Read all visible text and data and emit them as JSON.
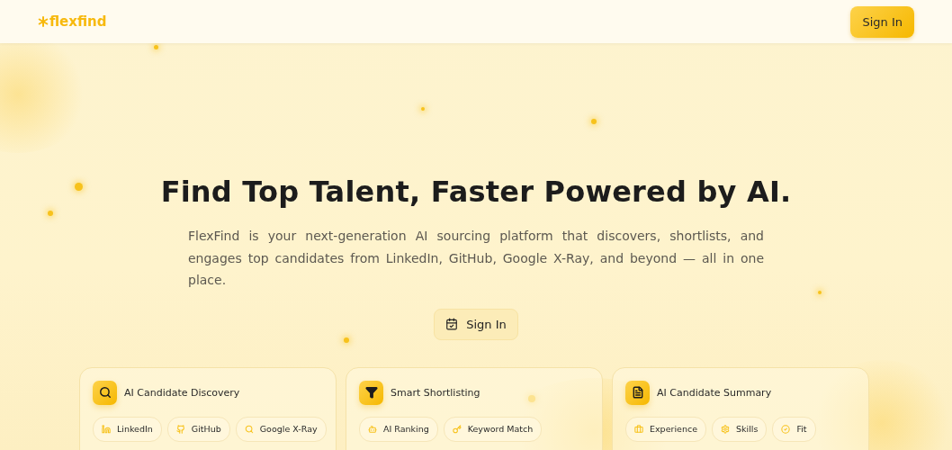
{
  "header": {
    "logo": "flexfind",
    "sign_in": "Sign In"
  },
  "hero": {
    "title": "Find Top Talent, Faster Powered by AI.",
    "description": "FlexFind is your next-generation AI sourcing platform that discovers, shortlists, and engages top candidates from LinkedIn, GitHub, Google X-Ray, and beyond — all in one place.",
    "button": "Sign In"
  },
  "features": [
    {
      "title": "AI Candidate Discovery",
      "tags": [
        "LinkedIn",
        "GitHub",
        "Google X-Ray"
      ]
    },
    {
      "title": "Smart Shortlisting",
      "tags": [
        "AI Ranking",
        "Keyword Match"
      ]
    },
    {
      "title": "AI Candidate Summary",
      "tags": [
        "Experience",
        "Skills",
        "Fit"
      ]
    }
  ]
}
